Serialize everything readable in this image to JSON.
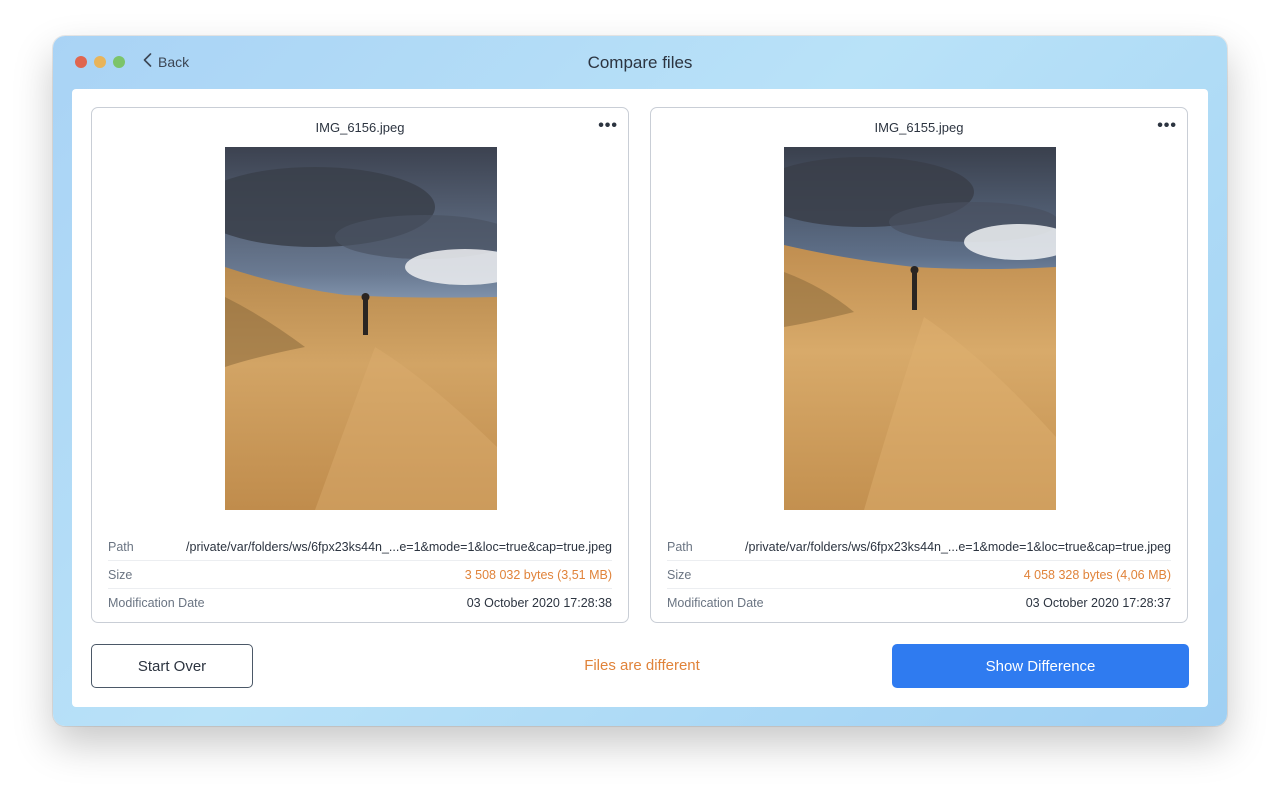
{
  "window": {
    "title": "Compare files",
    "back_label": "Back"
  },
  "files": [
    {
      "name": "IMG_6156.jpeg",
      "more_label": "•••",
      "path_label": "Path",
      "path": "/private/var/folders/ws/6fpx23ks44n_...e=1&mode=1&loc=true&cap=true.jpeg",
      "size_label": "Size",
      "size": "3 508 032 bytes (3,51 MB)",
      "date_label": "Modification Date",
      "date": "03 October 2020 17:28:38"
    },
    {
      "name": "IMG_6155.jpeg",
      "more_label": "•••",
      "path_label": "Path",
      "path": "/private/var/folders/ws/6fpx23ks44n_...e=1&mode=1&loc=true&cap=true.jpeg",
      "size_label": "Size",
      "size": "4 058 328 bytes (4,06 MB)",
      "date_label": "Modification Date",
      "date": "03 October 2020 17:28:37"
    }
  ],
  "footer": {
    "start_over_label": "Start Over",
    "status_text": "Files are different",
    "show_difference_label": "Show Difference"
  },
  "colors": {
    "accent": "#2f7bf0",
    "warning": "#e0833a"
  },
  "icons": {
    "back": "chevron-left-icon",
    "more": "more-horizontal-icon"
  }
}
